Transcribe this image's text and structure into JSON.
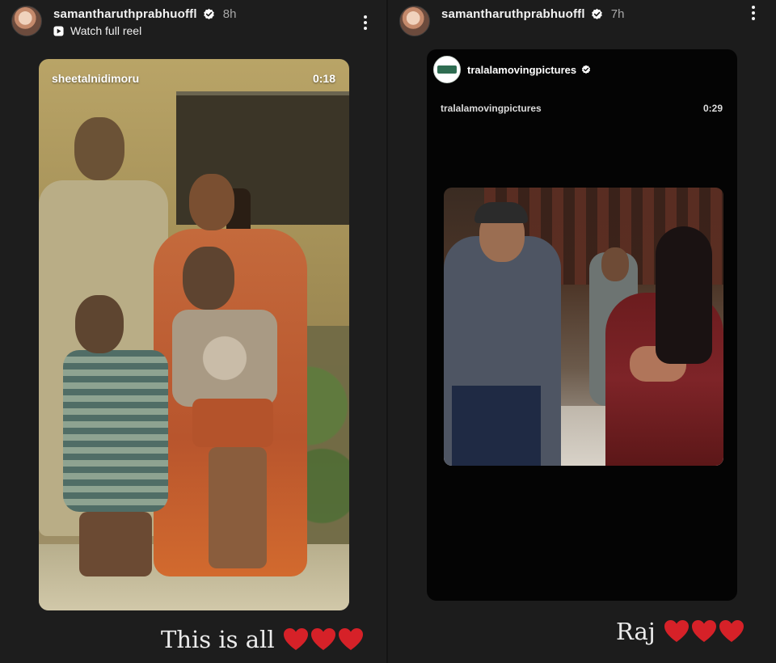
{
  "left_story": {
    "username": "samantharuthprabhuoffl",
    "time": "8h",
    "watch_label": "Watch full reel",
    "reel": {
      "author": "sheetalnidimoru",
      "duration": "0:18"
    },
    "caption": "This is all",
    "heart_count": 3
  },
  "right_story": {
    "username": "samantharuthprabhuoffl",
    "time": "7h",
    "post": {
      "account": "tralalamovingpictures",
      "subaccount": "tralalamovingpictures",
      "duration": "0:29"
    },
    "caption": "Raj",
    "heart_count": 3
  },
  "icons": {
    "verified": "verified-badge-icon",
    "more": "more-vertical-icon",
    "play": "play-icon",
    "heart": "red-heart-icon"
  },
  "colors": {
    "heart": "#d62128",
    "verified_badge": "#ffffff",
    "background": "#1f1f1f"
  }
}
